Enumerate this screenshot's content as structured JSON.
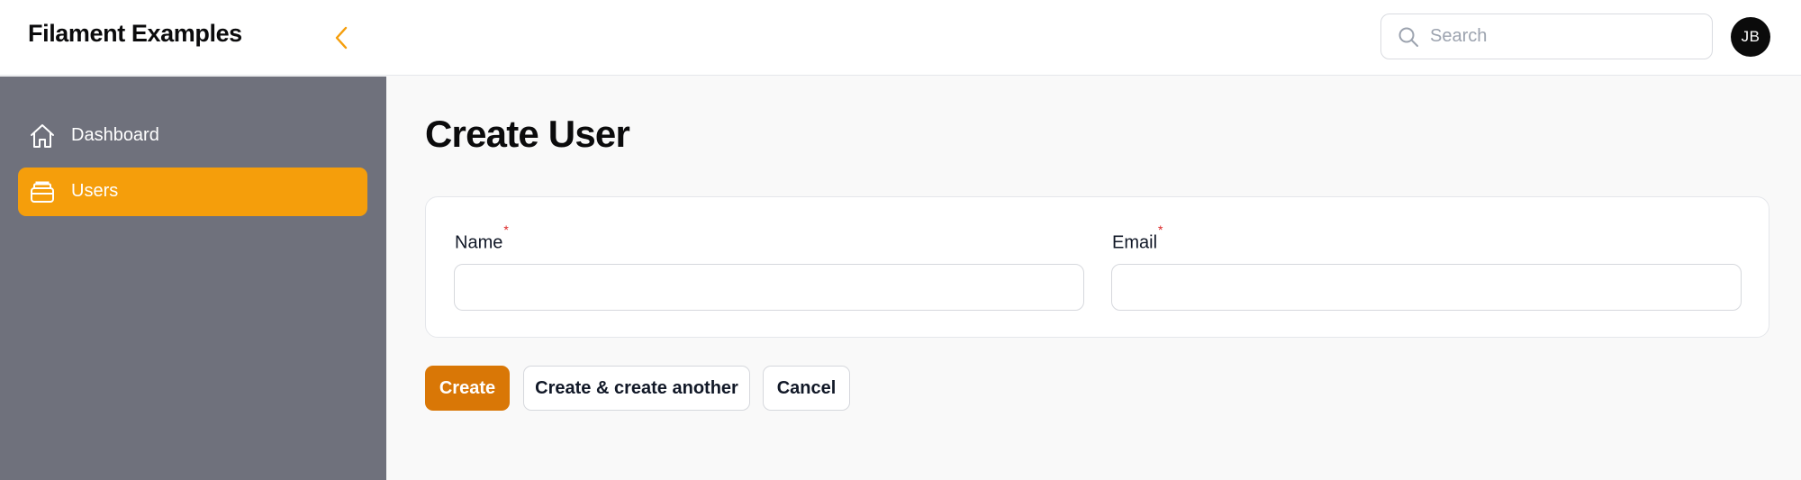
{
  "app": {
    "brand": "Filament Examples"
  },
  "colors": {
    "accent": "#f59e0b",
    "primary_button": "#d97706",
    "sidebar_bg": "#6f717c",
    "required": "#dc2626"
  },
  "header": {
    "collapse_icon": "chevron-left-icon",
    "search": {
      "placeholder": "Search",
      "value": "",
      "icon": "search-icon"
    },
    "avatar_initials": "JB"
  },
  "sidebar": {
    "items": [
      {
        "label": "Dashboard",
        "icon": "home-icon",
        "active": false
      },
      {
        "label": "Users",
        "icon": "inbox-stack-icon",
        "active": true
      }
    ]
  },
  "main": {
    "title": "Create User",
    "form": {
      "fields": [
        {
          "label": "Name",
          "required_mark": "*",
          "value": ""
        },
        {
          "label": "Email",
          "required_mark": "*",
          "value": ""
        }
      ]
    },
    "actions": {
      "create": "Create",
      "create_another": "Create & create another",
      "cancel": "Cancel"
    }
  }
}
